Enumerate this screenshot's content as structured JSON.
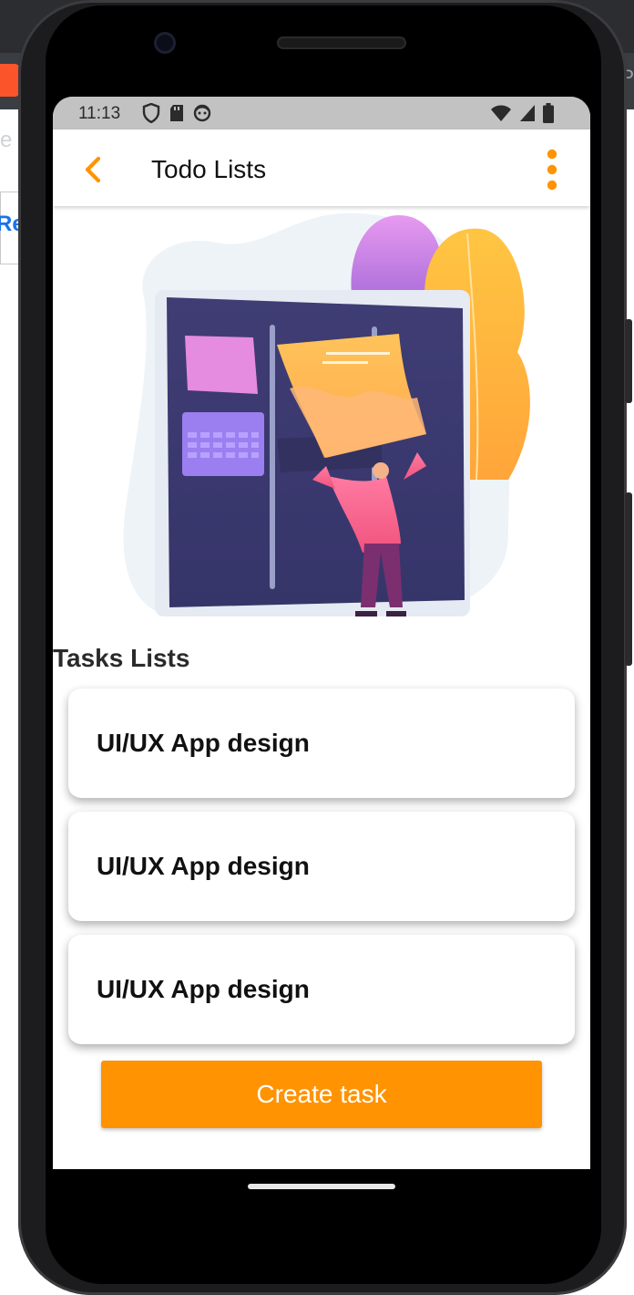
{
  "background": {
    "address_fragment": "e",
    "link_fragment": "Re",
    "right_fragment": "P"
  },
  "status_bar": {
    "time": "11:13",
    "left_icons": [
      "shield-icon",
      "sd-card-icon",
      "face-icon"
    ],
    "right_icons": [
      "wifi-icon",
      "signal-icon",
      "battery-icon"
    ]
  },
  "app_bar": {
    "title": "Todo Lists",
    "accent_color": "#FF9302"
  },
  "section": {
    "label": "Tasks Lists"
  },
  "tasks": [
    {
      "title": "UI/UX App design"
    },
    {
      "title": "UI/UX App design"
    },
    {
      "title": "UI/UX App design"
    }
  ],
  "create_button": {
    "label": "Create task",
    "color": "#FF9302"
  }
}
